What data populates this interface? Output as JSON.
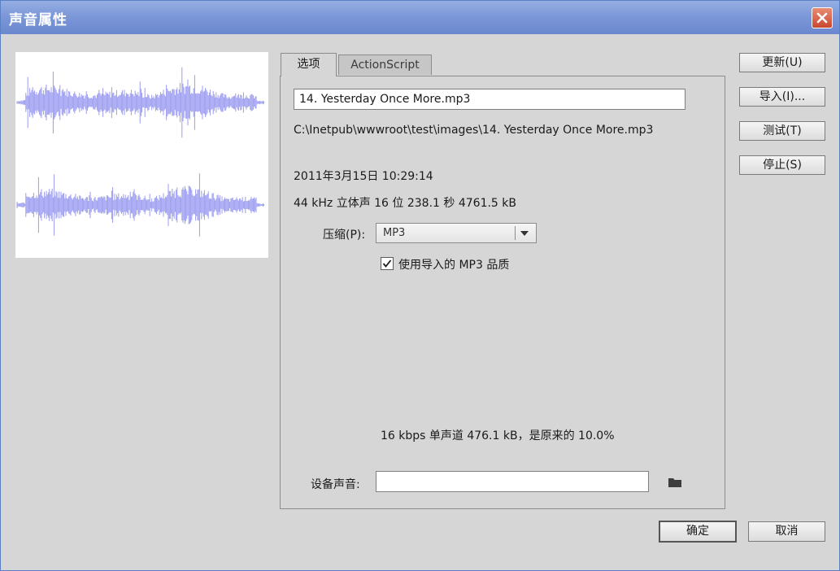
{
  "window": {
    "title": "声音属性"
  },
  "tabs": [
    {
      "label": "选项",
      "active": true
    },
    {
      "label": "ActionScript",
      "active": false
    }
  ],
  "sound": {
    "name_value": "14. Yesterday Once More.mp3",
    "path": "C:\\Inetpub\\wwwroot\\test\\images\\14. Yesterday Once More.mp3",
    "date": "2011年3月15日  10:29:14",
    "info": "44 kHz 立体声 16 位 238.1 秒 4761.5 kB"
  },
  "compression": {
    "label": "压缩(P):",
    "selected": "MP3"
  },
  "use_import_quality": {
    "label": "使用导入的 MP3 品质",
    "checked": true
  },
  "result_info": "16 kbps  单声道 476.1 kB，是原来的 10.0%",
  "device_sound": {
    "label": "设备声音:",
    "value": ""
  },
  "side_buttons": {
    "update": "更新(U)",
    "import": "导入(I)...",
    "test": "测试(T)",
    "stop": "停止(S)"
  },
  "footer_buttons": {
    "ok": "确定",
    "cancel": "取消"
  },
  "icons": {
    "close": "close-icon",
    "folder": "folder-icon",
    "check": "check-icon",
    "dropdown": "chevron-down-icon"
  },
  "colors": {
    "titlebar": "#7d98d8",
    "waveform": "#9b9bf0",
    "close_button": "#c8482f"
  }
}
